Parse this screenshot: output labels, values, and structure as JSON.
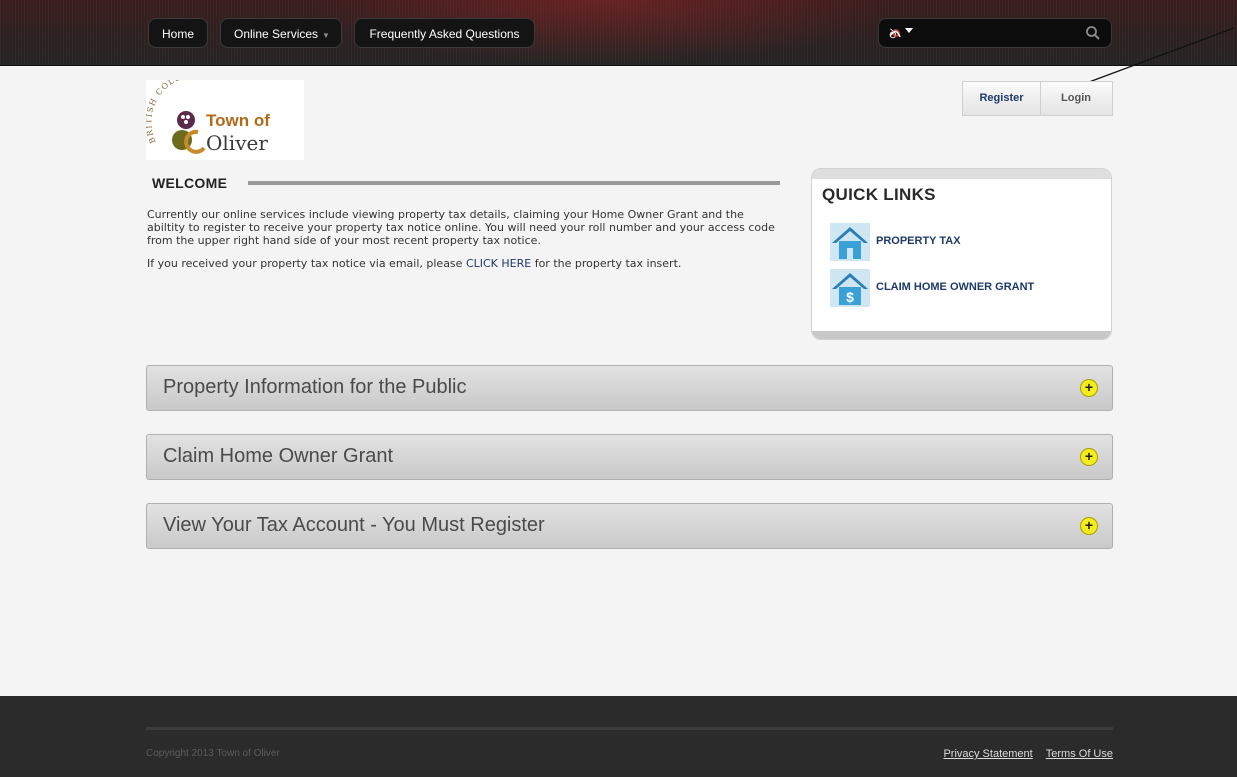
{
  "nav": {
    "home": "Home",
    "online_services": "Online Services",
    "faq": "Frequently Asked Questions"
  },
  "search": {
    "placeholder": "",
    "value": "",
    "language_icon": "translate-icon",
    "search_icon": "magnifier-icon"
  },
  "auth": {
    "register": "Register",
    "login": "Login"
  },
  "logo": {
    "arc_text": "BRITISH COLUMBIA",
    "line1": "Town of",
    "line2": "Oliver"
  },
  "welcome": {
    "title": "WELCOME",
    "para1": "Currently our online services include viewing property tax details, claiming your Home Owner Grant and the abiltity to register to receive your property tax notice online.  You will need your roll number and your access code from the upper right hand side of your most recent property tax notice.",
    "para2_before": "If you received your property tax notice via email, please ",
    "para2_link": "CLICK HERE",
    "para2_after": " for the property tax insert."
  },
  "quick_links": {
    "title": "QUICK LINKS",
    "items": [
      {
        "label": "PROPERTY TAX",
        "icon": "house-icon"
      },
      {
        "label": "CLAIM HOME OWNER GRANT",
        "icon": "house-dollar-icon"
      }
    ]
  },
  "accordions": [
    {
      "title": "Property Information for the Public",
      "icon": "plus"
    },
    {
      "title": "Claim Home Owner Grant",
      "icon": "plus"
    },
    {
      "title": "View Your Tax Account - You Must Register",
      "icon": "plus"
    }
  ],
  "footer": {
    "copyright": "Copyright 2013 Town of Oliver",
    "privacy": "Privacy Statement",
    "terms": "Terms Of Use"
  },
  "colors": {
    "link": "#1d3a6a",
    "accent_plus": "#f4ec1b",
    "icon_blue": "#3aa1d8"
  }
}
